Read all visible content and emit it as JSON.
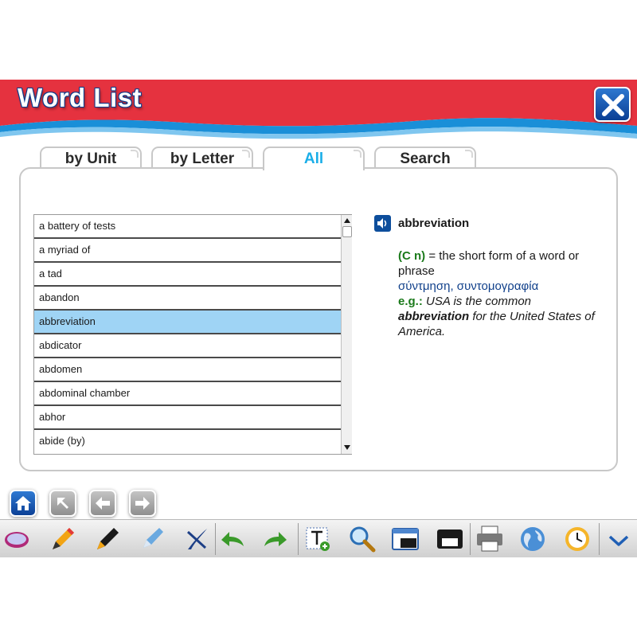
{
  "header": {
    "title": "Word List"
  },
  "tabs": [
    {
      "label": "by Unit"
    },
    {
      "label": "by Letter"
    },
    {
      "label": "All"
    },
    {
      "label": "Search"
    }
  ],
  "active_tab": "All",
  "word_list": {
    "items": [
      "a battery of tests",
      "a myriad of",
      "a tad",
      "abandon",
      "abbreviation",
      "abdicator",
      "abdomen",
      "abdominal chamber",
      "abhor",
      "abide (by)"
    ],
    "selected": "abbreviation"
  },
  "definition": {
    "word": "abbreviation",
    "pos": "(C n)",
    "meaning": "= the short form of a word or phrase",
    "translation": "σύντμηση, συντομογραφία",
    "eg_label": "e.g.:",
    "example_before": "USA is the common",
    "example_bold": "abbreviation",
    "example_after": "for the United States of America."
  },
  "colors": {
    "header_red": "#e5323f",
    "header_blue": "#1a8fd8",
    "accent_blue": "#1aaee8",
    "selected_row": "#9fd4f5",
    "definition_pos": "#1b7a1b",
    "translation": "#0f3f8a"
  },
  "nav_icons": [
    "home-icon",
    "up-left-arrow-icon",
    "left-arrow-icon",
    "right-arrow-icon"
  ],
  "toolbar_icons": [
    "eraser-icon",
    "pencil-icon",
    "marker-icon",
    "highlighter-icon",
    "clear-icon",
    "undo-icon",
    "redo-icon",
    "text-box-icon",
    "magnifier-icon",
    "window-icon",
    "minimize-icon",
    "print-icon",
    "globe-icon",
    "clock-icon",
    "collapse-icon"
  ]
}
